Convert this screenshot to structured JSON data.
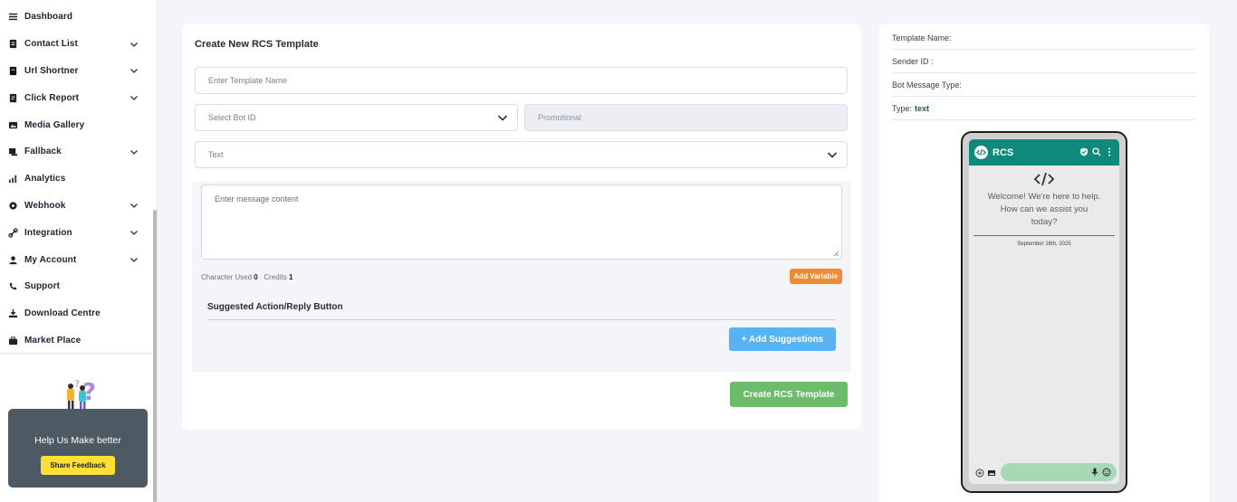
{
  "sidebar": {
    "items": [
      {
        "label": "Dashboard",
        "icon": "dashboard-icon",
        "has_submenu": false
      },
      {
        "label": "Contact List",
        "icon": "contact-list-icon",
        "has_submenu": true
      },
      {
        "label": "Url Shortner",
        "icon": "url-shortner-icon",
        "has_submenu": true
      },
      {
        "label": "Click Report",
        "icon": "click-report-icon",
        "has_submenu": true
      },
      {
        "label": "Media Gallery",
        "icon": "media-gallery-icon",
        "has_submenu": false
      },
      {
        "label": "Fallback",
        "icon": "fallback-icon",
        "has_submenu": true
      },
      {
        "label": "Analytics",
        "icon": "analytics-icon",
        "has_submenu": false
      },
      {
        "label": "Webhook",
        "icon": "webhook-icon",
        "has_submenu": true
      },
      {
        "label": "Integration",
        "icon": "integration-icon",
        "has_submenu": true
      },
      {
        "label": "My Account",
        "icon": "my-account-icon",
        "has_submenu": true
      },
      {
        "label": "Support",
        "icon": "support-icon",
        "has_submenu": false
      },
      {
        "label": "Download Centre",
        "icon": "download-centre-icon",
        "has_submenu": false
      },
      {
        "label": "Market Place",
        "icon": "market-place-icon",
        "has_submenu": false
      }
    ],
    "help": {
      "title": "Help Us Make better",
      "button": "Share Feedback"
    }
  },
  "form": {
    "title": "Create New RCS Template",
    "template_name_placeholder": "Enter Template Name",
    "bot_id_placeholder": "Select Bot ID",
    "category_value": "Promotional",
    "message_type_value": "Text",
    "message_placeholder": "Enter message content",
    "char_used_label": "Character Used",
    "char_used_value": "0",
    "credits_label": "Credits",
    "credits_value": "1",
    "add_variable_label": "Add Variable",
    "suggested_title": "Suggested Action/Reply Button",
    "add_suggestions_label": "+ Add Suggestions",
    "create_button_label": "Create RCS Template"
  },
  "preview": {
    "template_name_label": "Template Name:",
    "sender_id_label": "Sender ID :",
    "bot_message_type_label": "Bot Message Type:",
    "type_label": "Type:",
    "type_value": "text",
    "phone": {
      "brand": "RCS",
      "welcome_text": "Welcome! We're here to help. How can we assist you today?",
      "date": "September 16th, 2025"
    }
  },
  "colors": {
    "phone_header": "#0f8a7a",
    "add_variable": "#f08a33",
    "add_suggestions": "#58b3f3",
    "create_button": "#6cbc6c",
    "share_feedback": "#ffe033",
    "help_card": "#4d5963"
  }
}
